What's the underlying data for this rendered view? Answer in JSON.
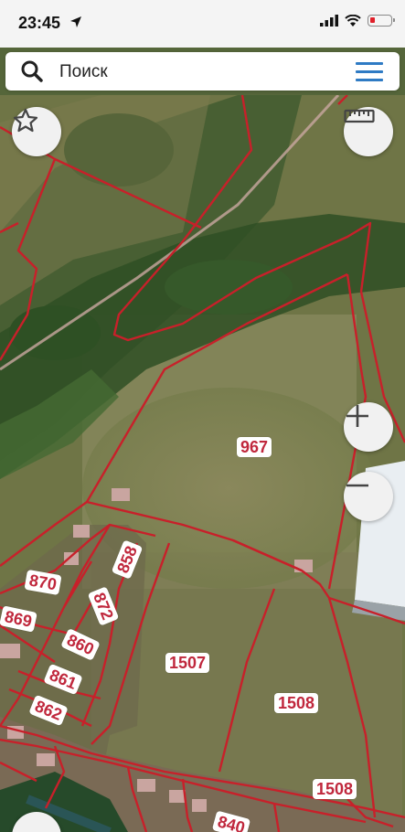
{
  "status_bar": {
    "time": "23:45",
    "battery_color": "#e0202a"
  },
  "search": {
    "placeholder": "Поиск",
    "icon": "search-icon"
  },
  "menu": {
    "icon": "hamburger-menu-icon",
    "color": "#2f7bc4"
  },
  "map_controls": {
    "favorite": "star-icon",
    "measure": "ruler-icon",
    "zoom_in": "+",
    "zoom_out": "−"
  },
  "plot_labels": [
    {
      "id": "967",
      "text": "967"
    },
    {
      "id": "858",
      "text": "858"
    },
    {
      "id": "870",
      "text": "870"
    },
    {
      "id": "872",
      "text": "872"
    },
    {
      "id": "869",
      "text": "869"
    },
    {
      "id": "860",
      "text": "860"
    },
    {
      "id": "861",
      "text": "861"
    },
    {
      "id": "862",
      "text": "862"
    },
    {
      "id": "1507",
      "text": "1507"
    },
    {
      "id": "1508a",
      "text": "1508"
    },
    {
      "id": "1508b",
      "text": "1508"
    },
    {
      "id": "840",
      "text": "840"
    }
  ],
  "colors": {
    "boundary": "#c8202a",
    "label_text": "#c0283d"
  }
}
